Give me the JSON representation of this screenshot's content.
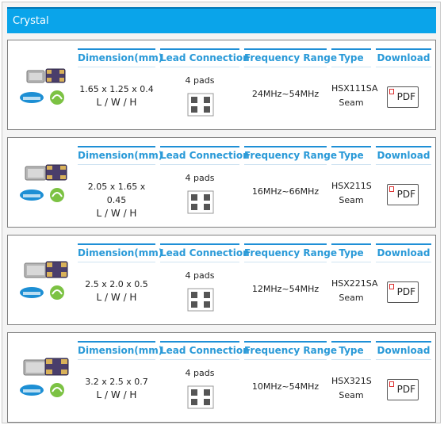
{
  "section_title": "Crystal",
  "columns": {
    "dimension": "Dimension(mm)",
    "lead": "Lead Connection",
    "frequency": "Frequency Range",
    "type": "Type",
    "download": "Download"
  },
  "products": [
    {
      "dimension": "1.65 x 1.25 x 0.4",
      "lwh": "L / W / H",
      "lead": "4 pads",
      "frequency": "24MHz~54MHz",
      "type_line1": "HSX111SA",
      "type_line2": "Seam",
      "pdf_label": "PDF"
    },
    {
      "dimension": "2.05 x 1.65 x 0.45",
      "lwh": "L / W / H",
      "lead": "4 pads",
      "frequency": "16MHz~66MHz",
      "type_line1": "HSX211S",
      "type_line2": "Seam",
      "pdf_label": "PDF"
    },
    {
      "dimension": "2.5 x 2.0 x 0.5",
      "lwh": "L / W / H",
      "lead": "4 pads",
      "frequency": "12MHz~54MHz",
      "type_line1": "HSX221SA",
      "type_line2": "Seam",
      "pdf_label": "PDF"
    },
    {
      "dimension": "3.2 x 2.5 x 0.7",
      "lwh": "L / W / H",
      "lead": "4 pads",
      "frequency": "10MHz~54MHz",
      "type_line1": "HSX321S",
      "type_line2": "Seam",
      "pdf_label": "PDF"
    }
  ],
  "colors": {
    "header_bg": "#0aa4ea",
    "column_header_text": "#2a9ad8",
    "column_rule": "#1e8fd6"
  },
  "icons": [
    "crystal-product-image",
    "rohs-badge",
    "pb-free-badge",
    "pad-layout-icon",
    "pdf-icon"
  ]
}
